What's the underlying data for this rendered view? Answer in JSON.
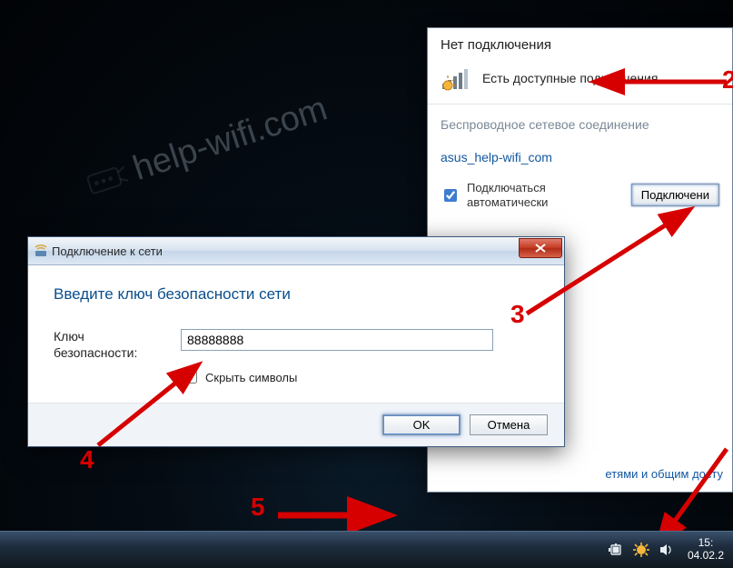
{
  "watermark": "help-wifi.com",
  "network_popup": {
    "heading": "Нет подключения",
    "status": "Есть доступные подключения",
    "section": "Беспроводное сетевое соединение",
    "network": "asus_help-wifi_com",
    "auto_label": "Подключаться автоматически",
    "auto_checked": true,
    "connect_label": "Подключени",
    "footer_link": "етями и общим досту"
  },
  "dialog": {
    "title": "Подключение к сети",
    "heading": "Введите ключ безопасности сети",
    "key_label": "Ключ безопасности:",
    "key_value": "88888888",
    "hide_label": "Скрыть символы",
    "hide_checked": false,
    "ok": "OK",
    "cancel": "Отмена"
  },
  "taskbar": {
    "time": "15:",
    "date": "04.02.2"
  },
  "callouts": {
    "c2": "2",
    "c3": "3",
    "c4": "4",
    "c5": "5"
  }
}
